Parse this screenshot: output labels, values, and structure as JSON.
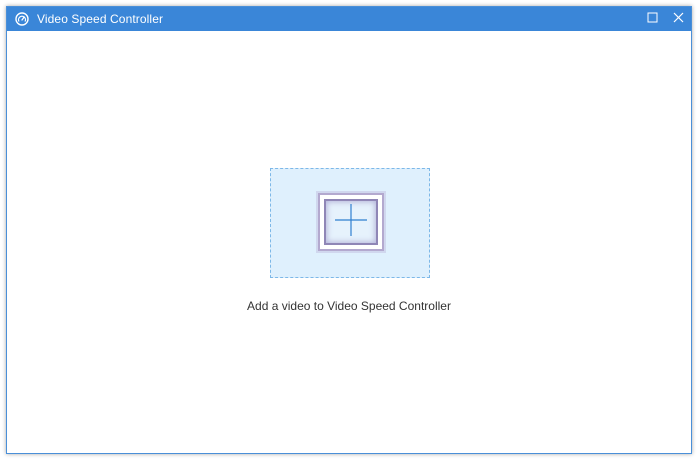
{
  "window": {
    "title": "Video Speed Controller",
    "app_icon": "speedometer-icon",
    "controls": {
      "maximize_icon": "maximize-icon",
      "close_icon": "close-icon"
    }
  },
  "main": {
    "add_icon": "plus-icon",
    "add_label": "Add a video to Video Speed Controller"
  },
  "colors": {
    "titlebar": "#3a86d8",
    "dropzone_bg": "#dff0fd",
    "dropzone_border": "#7db8e8",
    "plus": "#2f7fd0"
  }
}
